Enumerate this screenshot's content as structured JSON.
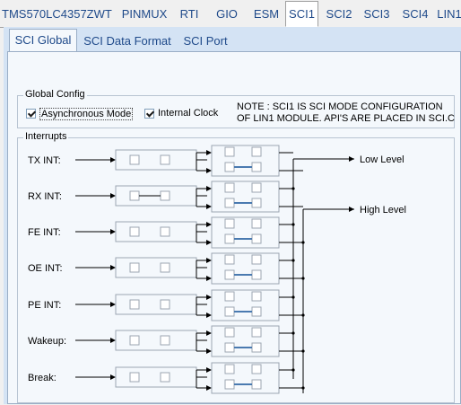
{
  "top_tabs": [
    "TMS570LC4357ZWT",
    "PINMUX",
    "RTI",
    "GIO",
    "ESM",
    "SCI1",
    "SCI2",
    "SCI3",
    "SCI4",
    "LIN1"
  ],
  "active_top_tab": "SCI1",
  "sub_tabs": [
    "SCI Global",
    "SCI Data Format",
    "SCI Port"
  ],
  "active_sub_tab": "SCI Global",
  "global_config": {
    "title": "Global Config",
    "async_mode_label": "Asynchronous Mode",
    "async_mode_checked": true,
    "internal_clock_label": "Internal Clock",
    "internal_clock_checked": true,
    "note_line1": "NOTE : SCI1 IS SCI MODE CONFIGURATION",
    "note_line2": "OF LIN1 MODULE. API'S ARE PLACED IN SCI.C"
  },
  "interrupts": {
    "title": "Interrupts",
    "rows": [
      {
        "label": "TX INT:",
        "enabled": false
      },
      {
        "label": "RX INT:",
        "enabled": true
      },
      {
        "label": "FE INT:",
        "enabled": false
      },
      {
        "label": "OE INT:",
        "enabled": false
      },
      {
        "label": "PE INT:",
        "enabled": false
      },
      {
        "label": "Wakeup:",
        "enabled": false
      },
      {
        "label": "Break:",
        "enabled": false
      }
    ],
    "low_level_label": "Low Level",
    "high_level_label": "High Level"
  }
}
